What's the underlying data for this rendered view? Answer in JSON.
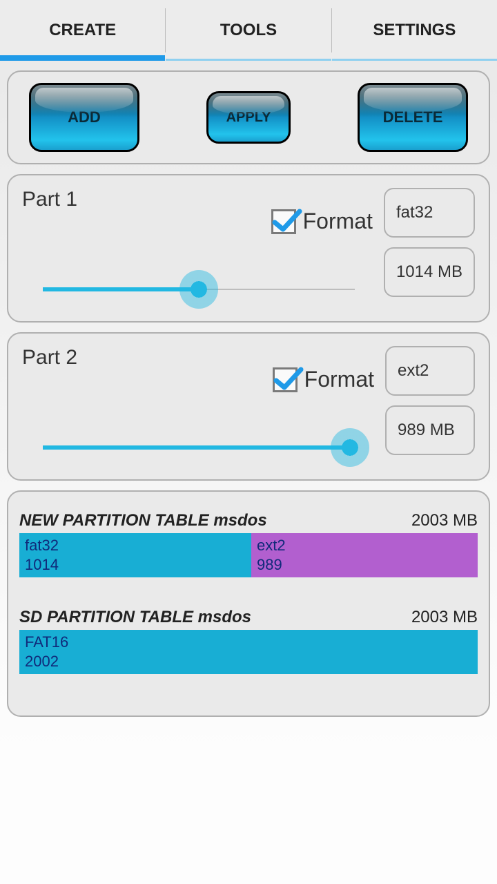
{
  "tabs": {
    "create": "CREATE",
    "tools": "TOOLS",
    "settings": "SETTINGS",
    "active": "create"
  },
  "toolbar": {
    "add": "ADD",
    "apply": "APPLY",
    "delete": "DELETE"
  },
  "parts": [
    {
      "title": "Part 1",
      "format_label": "Format",
      "format_checked": true,
      "fs": "fat32",
      "size_label": "1014 MB",
      "slider_pct": 50
    },
    {
      "title": "Part 2",
      "format_label": "Format",
      "format_checked": true,
      "fs": "ext2",
      "size_label": "989 MB",
      "slider_pct": 98
    }
  ],
  "tables": {
    "new": {
      "title": "NEW PARTITION TABLE msdos",
      "total": "2003 MB",
      "segments": [
        {
          "fs": "fat32",
          "size": "1014",
          "width_pct": 50.6,
          "color": "cyan"
        },
        {
          "fs": "ext2",
          "size": "989",
          "width_pct": 49.4,
          "color": "purple"
        }
      ]
    },
    "sd": {
      "title": "SD PARTITION TABLE msdos",
      "total": "2003 MB",
      "segments": [
        {
          "fs": "FAT16",
          "size": "2002",
          "width_pct": 100,
          "color": "cyan"
        }
      ]
    }
  }
}
